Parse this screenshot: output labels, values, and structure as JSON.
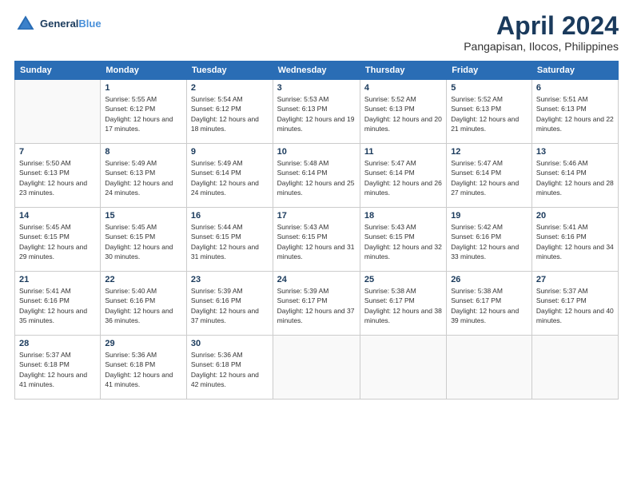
{
  "logo": {
    "line1": "General",
    "line2": "Blue"
  },
  "title": "April 2024",
  "subtitle": "Pangapisan, Ilocos, Philippines",
  "days_of_week": [
    "Sunday",
    "Monday",
    "Tuesday",
    "Wednesday",
    "Thursday",
    "Friday",
    "Saturday"
  ],
  "weeks": [
    [
      {
        "day": "",
        "sunrise": "",
        "sunset": "",
        "daylight": ""
      },
      {
        "day": "1",
        "sunrise": "Sunrise: 5:55 AM",
        "sunset": "Sunset: 6:12 PM",
        "daylight": "Daylight: 12 hours and 17 minutes."
      },
      {
        "day": "2",
        "sunrise": "Sunrise: 5:54 AM",
        "sunset": "Sunset: 6:12 PM",
        "daylight": "Daylight: 12 hours and 18 minutes."
      },
      {
        "day": "3",
        "sunrise": "Sunrise: 5:53 AM",
        "sunset": "Sunset: 6:13 PM",
        "daylight": "Daylight: 12 hours and 19 minutes."
      },
      {
        "day": "4",
        "sunrise": "Sunrise: 5:52 AM",
        "sunset": "Sunset: 6:13 PM",
        "daylight": "Daylight: 12 hours and 20 minutes."
      },
      {
        "day": "5",
        "sunrise": "Sunrise: 5:52 AM",
        "sunset": "Sunset: 6:13 PM",
        "daylight": "Daylight: 12 hours and 21 minutes."
      },
      {
        "day": "6",
        "sunrise": "Sunrise: 5:51 AM",
        "sunset": "Sunset: 6:13 PM",
        "daylight": "Daylight: 12 hours and 22 minutes."
      }
    ],
    [
      {
        "day": "7",
        "sunrise": "Sunrise: 5:50 AM",
        "sunset": "Sunset: 6:13 PM",
        "daylight": "Daylight: 12 hours and 23 minutes."
      },
      {
        "day": "8",
        "sunrise": "Sunrise: 5:49 AM",
        "sunset": "Sunset: 6:13 PM",
        "daylight": "Daylight: 12 hours and 24 minutes."
      },
      {
        "day": "9",
        "sunrise": "Sunrise: 5:49 AM",
        "sunset": "Sunset: 6:14 PM",
        "daylight": "Daylight: 12 hours and 24 minutes."
      },
      {
        "day": "10",
        "sunrise": "Sunrise: 5:48 AM",
        "sunset": "Sunset: 6:14 PM",
        "daylight": "Daylight: 12 hours and 25 minutes."
      },
      {
        "day": "11",
        "sunrise": "Sunrise: 5:47 AM",
        "sunset": "Sunset: 6:14 PM",
        "daylight": "Daylight: 12 hours and 26 minutes."
      },
      {
        "day": "12",
        "sunrise": "Sunrise: 5:47 AM",
        "sunset": "Sunset: 6:14 PM",
        "daylight": "Daylight: 12 hours and 27 minutes."
      },
      {
        "day": "13",
        "sunrise": "Sunrise: 5:46 AM",
        "sunset": "Sunset: 6:14 PM",
        "daylight": "Daylight: 12 hours and 28 minutes."
      }
    ],
    [
      {
        "day": "14",
        "sunrise": "Sunrise: 5:45 AM",
        "sunset": "Sunset: 6:15 PM",
        "daylight": "Daylight: 12 hours and 29 minutes."
      },
      {
        "day": "15",
        "sunrise": "Sunrise: 5:45 AM",
        "sunset": "Sunset: 6:15 PM",
        "daylight": "Daylight: 12 hours and 30 minutes."
      },
      {
        "day": "16",
        "sunrise": "Sunrise: 5:44 AM",
        "sunset": "Sunset: 6:15 PM",
        "daylight": "Daylight: 12 hours and 31 minutes."
      },
      {
        "day": "17",
        "sunrise": "Sunrise: 5:43 AM",
        "sunset": "Sunset: 6:15 PM",
        "daylight": "Daylight: 12 hours and 31 minutes."
      },
      {
        "day": "18",
        "sunrise": "Sunrise: 5:43 AM",
        "sunset": "Sunset: 6:15 PM",
        "daylight": "Daylight: 12 hours and 32 minutes."
      },
      {
        "day": "19",
        "sunrise": "Sunrise: 5:42 AM",
        "sunset": "Sunset: 6:16 PM",
        "daylight": "Daylight: 12 hours and 33 minutes."
      },
      {
        "day": "20",
        "sunrise": "Sunrise: 5:41 AM",
        "sunset": "Sunset: 6:16 PM",
        "daylight": "Daylight: 12 hours and 34 minutes."
      }
    ],
    [
      {
        "day": "21",
        "sunrise": "Sunrise: 5:41 AM",
        "sunset": "Sunset: 6:16 PM",
        "daylight": "Daylight: 12 hours and 35 minutes."
      },
      {
        "day": "22",
        "sunrise": "Sunrise: 5:40 AM",
        "sunset": "Sunset: 6:16 PM",
        "daylight": "Daylight: 12 hours and 36 minutes."
      },
      {
        "day": "23",
        "sunrise": "Sunrise: 5:39 AM",
        "sunset": "Sunset: 6:16 PM",
        "daylight": "Daylight: 12 hours and 37 minutes."
      },
      {
        "day": "24",
        "sunrise": "Sunrise: 5:39 AM",
        "sunset": "Sunset: 6:17 PM",
        "daylight": "Daylight: 12 hours and 37 minutes."
      },
      {
        "day": "25",
        "sunrise": "Sunrise: 5:38 AM",
        "sunset": "Sunset: 6:17 PM",
        "daylight": "Daylight: 12 hours and 38 minutes."
      },
      {
        "day": "26",
        "sunrise": "Sunrise: 5:38 AM",
        "sunset": "Sunset: 6:17 PM",
        "daylight": "Daylight: 12 hours and 39 minutes."
      },
      {
        "day": "27",
        "sunrise": "Sunrise: 5:37 AM",
        "sunset": "Sunset: 6:17 PM",
        "daylight": "Daylight: 12 hours and 40 minutes."
      }
    ],
    [
      {
        "day": "28",
        "sunrise": "Sunrise: 5:37 AM",
        "sunset": "Sunset: 6:18 PM",
        "daylight": "Daylight: 12 hours and 41 minutes."
      },
      {
        "day": "29",
        "sunrise": "Sunrise: 5:36 AM",
        "sunset": "Sunset: 6:18 PM",
        "daylight": "Daylight: 12 hours and 41 minutes."
      },
      {
        "day": "30",
        "sunrise": "Sunrise: 5:36 AM",
        "sunset": "Sunset: 6:18 PM",
        "daylight": "Daylight: 12 hours and 42 minutes."
      },
      {
        "day": "",
        "sunrise": "",
        "sunset": "",
        "daylight": ""
      },
      {
        "day": "",
        "sunrise": "",
        "sunset": "",
        "daylight": ""
      },
      {
        "day": "",
        "sunrise": "",
        "sunset": "",
        "daylight": ""
      },
      {
        "day": "",
        "sunrise": "",
        "sunset": "",
        "daylight": ""
      }
    ]
  ]
}
